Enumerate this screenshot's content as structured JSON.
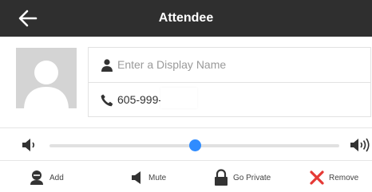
{
  "header": {
    "title": "Attendee",
    "back_icon": "arrow-left-icon",
    "background": "#2f2f2f"
  },
  "avatar": {
    "icon": "user-silhouette-icon"
  },
  "form": {
    "display_name": {
      "placeholder": "Enter a Display Name",
      "value": "",
      "icon": "person-icon"
    },
    "phone": {
      "value": "605-999-",
      "icon": "phone-icon"
    }
  },
  "volume": {
    "low_icon": "volume-low-icon",
    "high_icon": "volume-high-icon",
    "level": 0.5,
    "accent": "#2f8cff"
  },
  "actions": [
    {
      "label": "Add",
      "icon": "add-user-icon"
    },
    {
      "label": "Mute",
      "icon": "mute-icon"
    },
    {
      "label": "Go Private",
      "icon": "lock-icon"
    },
    {
      "label": "Remove",
      "icon": "remove-x-icon",
      "color": "#e53935"
    }
  ]
}
